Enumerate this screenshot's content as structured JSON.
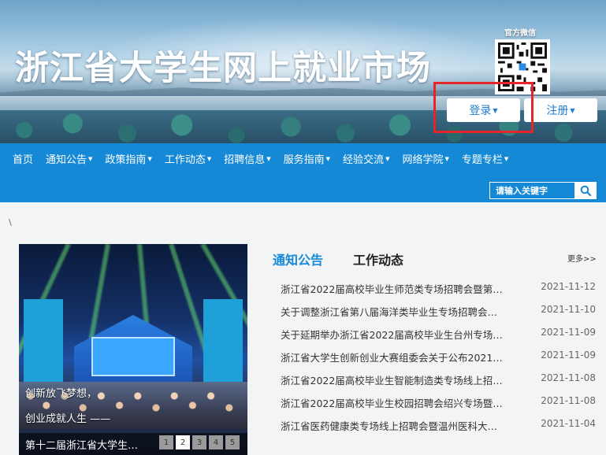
{
  "header": {
    "site_title": "浙江省大学生网上就业市场",
    "wechat_label": "官方微信",
    "login_label": "登录",
    "register_label": "注册"
  },
  "nav": {
    "items": [
      {
        "label": "首页",
        "dropdown": false
      },
      {
        "label": "通知公告",
        "dropdown": true
      },
      {
        "label": "政策指南",
        "dropdown": true
      },
      {
        "label": "工作动态",
        "dropdown": true
      },
      {
        "label": "招聘信息",
        "dropdown": true
      },
      {
        "label": "服务指南",
        "dropdown": true
      },
      {
        "label": "经验交流",
        "dropdown": true
      },
      {
        "label": "网络学院",
        "dropdown": true
      },
      {
        "label": "专题专栏",
        "dropdown": true
      }
    ],
    "search_placeholder": "请输入关键字"
  },
  "breadcrumb": "\\",
  "slider": {
    "caption_line1": "创新放飞梦想，",
    "caption_line2": "创业成就人生 ——",
    "title": "第十二届浙江省大学生…",
    "pages": [
      "1",
      "2",
      "3",
      "4",
      "5"
    ],
    "active_page": "2"
  },
  "news": {
    "tabs": [
      {
        "label": "通知公告",
        "active": true
      },
      {
        "label": "工作动态",
        "active": false
      }
    ],
    "more_label": "更多>>",
    "items": [
      {
        "title": "浙江省2022届高校毕业生师范类专场招聘会暨第…",
        "date": "2021-11-12"
      },
      {
        "title": "关于调整浙江省第八届海洋类毕业生专场招聘会…",
        "date": "2021-11-10"
      },
      {
        "title": "关于延期举办浙江省2022届高校毕业生台州专场…",
        "date": "2021-11-09"
      },
      {
        "title": "浙江省大学生创新创业大赛组委会关于公布2021…",
        "date": "2021-11-09"
      },
      {
        "title": "浙江省2022届高校毕业生智能制造类专场线上招…",
        "date": "2021-11-08"
      },
      {
        "title": "浙江省2022届高校毕业生校园招聘会绍兴专场暨…",
        "date": "2021-11-08"
      },
      {
        "title": "浙江省医药健康类专场线上招聘会暨温州医科大…",
        "date": "2021-11-04"
      }
    ]
  },
  "colors": {
    "nav_blue": "#1689d6",
    "highlight_red": "#e5252a",
    "link_blue": "#1f7ccf"
  }
}
